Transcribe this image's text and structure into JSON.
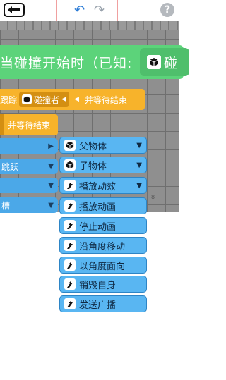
{
  "toolbar": {
    "back_icon": "arrow-left-icon",
    "undo_icon": "undo-icon",
    "redo_icon": "redo-icon",
    "help_label": "?"
  },
  "event": {
    "text": "当碰撞开始时（已知:",
    "object_label": "碰"
  },
  "orange_blocks": [
    {
      "left_text": "跟踪",
      "chip_label": "碰撞者",
      "right_text": "并等待结束"
    },
    {
      "right_text": "并等待结束"
    }
  ],
  "blue_blocks": [
    {
      "label": ""
    },
    {
      "label": "跳跃"
    },
    {
      "label": ""
    },
    {
      "label": "槽"
    }
  ],
  "grid_number": "8",
  "menu": {
    "items": [
      {
        "label": "父物体",
        "icon": "cube-icon",
        "has_caret": true
      },
      {
        "label": "子物体",
        "icon": "cube-icon",
        "has_caret": true
      },
      {
        "label": "播放动效",
        "icon": "sprite-icon",
        "has_caret": true
      },
      {
        "label": "播放动画",
        "icon": "sprite-icon",
        "has_caret": false
      },
      {
        "label": "停止动画",
        "icon": "sprite-icon",
        "has_caret": false
      },
      {
        "label": "沿角度移动",
        "icon": "sprite-icon",
        "has_caret": false
      },
      {
        "label": "以角度面向",
        "icon": "sprite-icon",
        "has_caret": false
      },
      {
        "label": "销毁自身",
        "icon": "sprite-icon",
        "has_caret": false
      },
      {
        "label": "发送广播",
        "icon": "sprite-icon",
        "has_caret": false
      }
    ]
  },
  "colors": {
    "event_green": "#5cd37a",
    "action_orange": "#f7b32b",
    "block_blue": "#4ba8e8",
    "menu_blue": "#59b6f2"
  }
}
